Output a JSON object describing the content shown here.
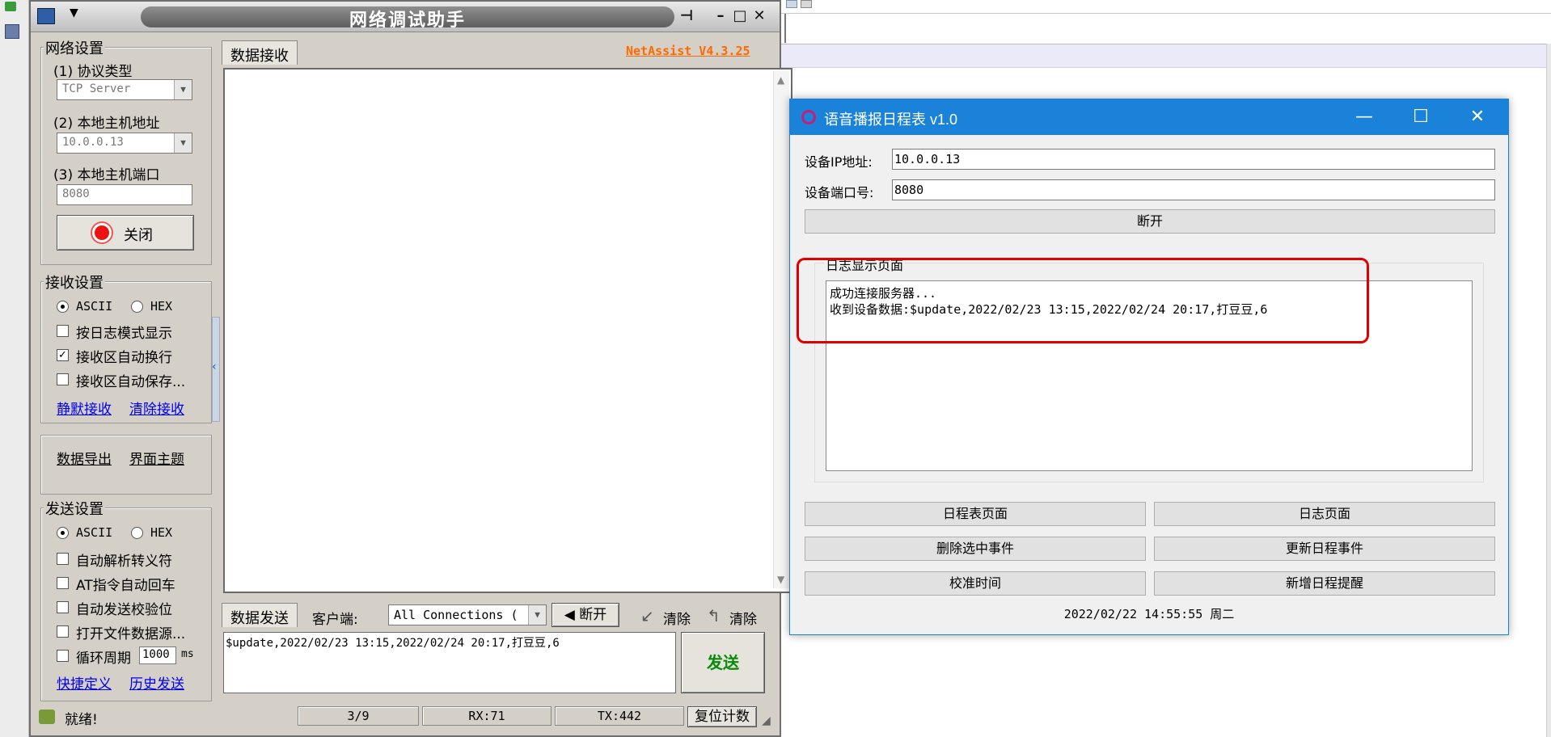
{
  "netassist": {
    "title": "网络调试助手",
    "version_link": "NetAssist V4.3.25",
    "net_settings": {
      "group_label": "网络设置",
      "protocol_label": "(1) 协议类型",
      "protocol_value": "TCP Server",
      "host_label": "(2) 本地主机地址",
      "host_value": "10.0.0.13",
      "port_label": "(3) 本地主机端口",
      "port_value": "8080",
      "close_button": "关闭"
    },
    "recv_settings": {
      "group_label": "接收设置",
      "ascii": "ASCII",
      "hex": "HEX",
      "log_mode": "按日志模式显示",
      "auto_wrap": "接收区自动换行",
      "auto_save": "接收区自动保存...",
      "mute_link": "静默接收",
      "clear_link": "清除接收"
    },
    "export_link": "数据导出",
    "theme_link": "界面主题",
    "send_settings": {
      "group_label": "发送设置",
      "ascii": "ASCII",
      "hex": "HEX",
      "parse_escape": "自动解析转义符",
      "at_cr": "AT指令自动回车",
      "auto_checksum": "自动发送校验位",
      "open_file": "打开文件数据源...",
      "loop_period": "循环周期",
      "loop_value": "1000",
      "loop_unit": "ms",
      "shortcut_link": "快捷定义",
      "history_link": "历史发送"
    },
    "recv_tab": "数据接收",
    "send_tab": "数据发送",
    "client_label": "客户端:",
    "client_value": "All Connections (",
    "disconnect_button": "断开",
    "clear1": "清除",
    "clear2": "清除",
    "send_text": "$update,2022/02/23 13:15,2022/02/24 20:17,打豆豆,6",
    "send_button": "发送",
    "status": {
      "ready": "就绪!",
      "count": "3/9",
      "rx": "RX:71",
      "tx": "TX:442",
      "reset": "复位计数"
    }
  },
  "schedule": {
    "title": "语音播报日程表 v1.0",
    "ip_label": "设备IP地址:",
    "ip_value": "10.0.0.13",
    "port_label": "设备端口号:",
    "port_value": "8080",
    "disconnect_button": "断开",
    "log_group_label": "日志显示页面",
    "log_lines": [
      "成功连接服务器...",
      "收到设备数据:$update,2022/02/23 13:15,2022/02/24 20:17,打豆豆,6"
    ],
    "buttons": {
      "schedule_page": "日程表页面",
      "log_page": "日志页面",
      "delete_event": "删除选中事件",
      "update_event": "更新日程事件",
      "sync_time": "校准时间",
      "add_reminder": "新增日程提醒"
    },
    "datetime": "2022/02/22 14:55:55 周二",
    "highlight_color": "#e00000",
    "accent_color": "#1a83d9"
  }
}
